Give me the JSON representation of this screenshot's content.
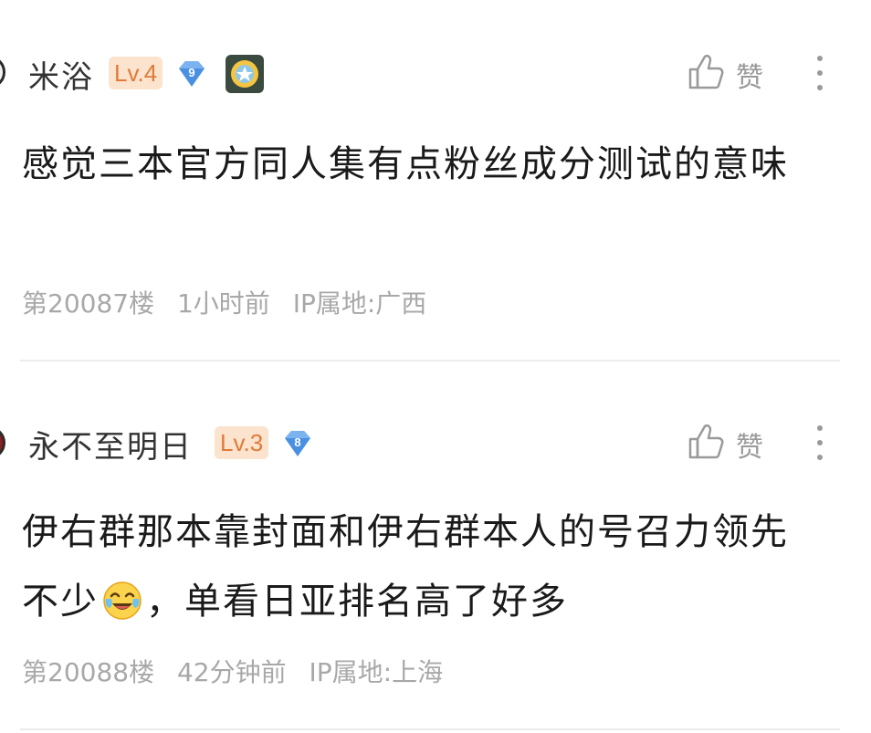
{
  "comments": [
    {
      "username": "米浴",
      "level": "Lv.4",
      "badge_number": "9",
      "has_medal": true,
      "like_label": "赞",
      "content": "感觉三本官方同人集有点粉丝成分测试的意味",
      "floor": "第20087楼",
      "time": "1小时前",
      "ip_location": "IP属地:广西"
    },
    {
      "username": "永不至明日",
      "level": "Lv.3",
      "badge_number": "8",
      "has_medal": false,
      "like_label": "赞",
      "content_before_emoji": "伊右群那本靠封面和伊右群本人的号召力领先不少",
      "emoji": "laughing-crying-emoji",
      "content_after_emoji": "，单看日亚排名高了好多",
      "floor": "第20088楼",
      "time": "42分钟前",
      "ip_location": "IP属地:上海"
    }
  ],
  "colors": {
    "level_badge_bg": "#fbe3cd",
    "level_badge_text": "#e07b3a",
    "gem_blue": "#4a90e2",
    "meta_text": "#a8a8a8",
    "like_icon": "#9a9a9a"
  }
}
